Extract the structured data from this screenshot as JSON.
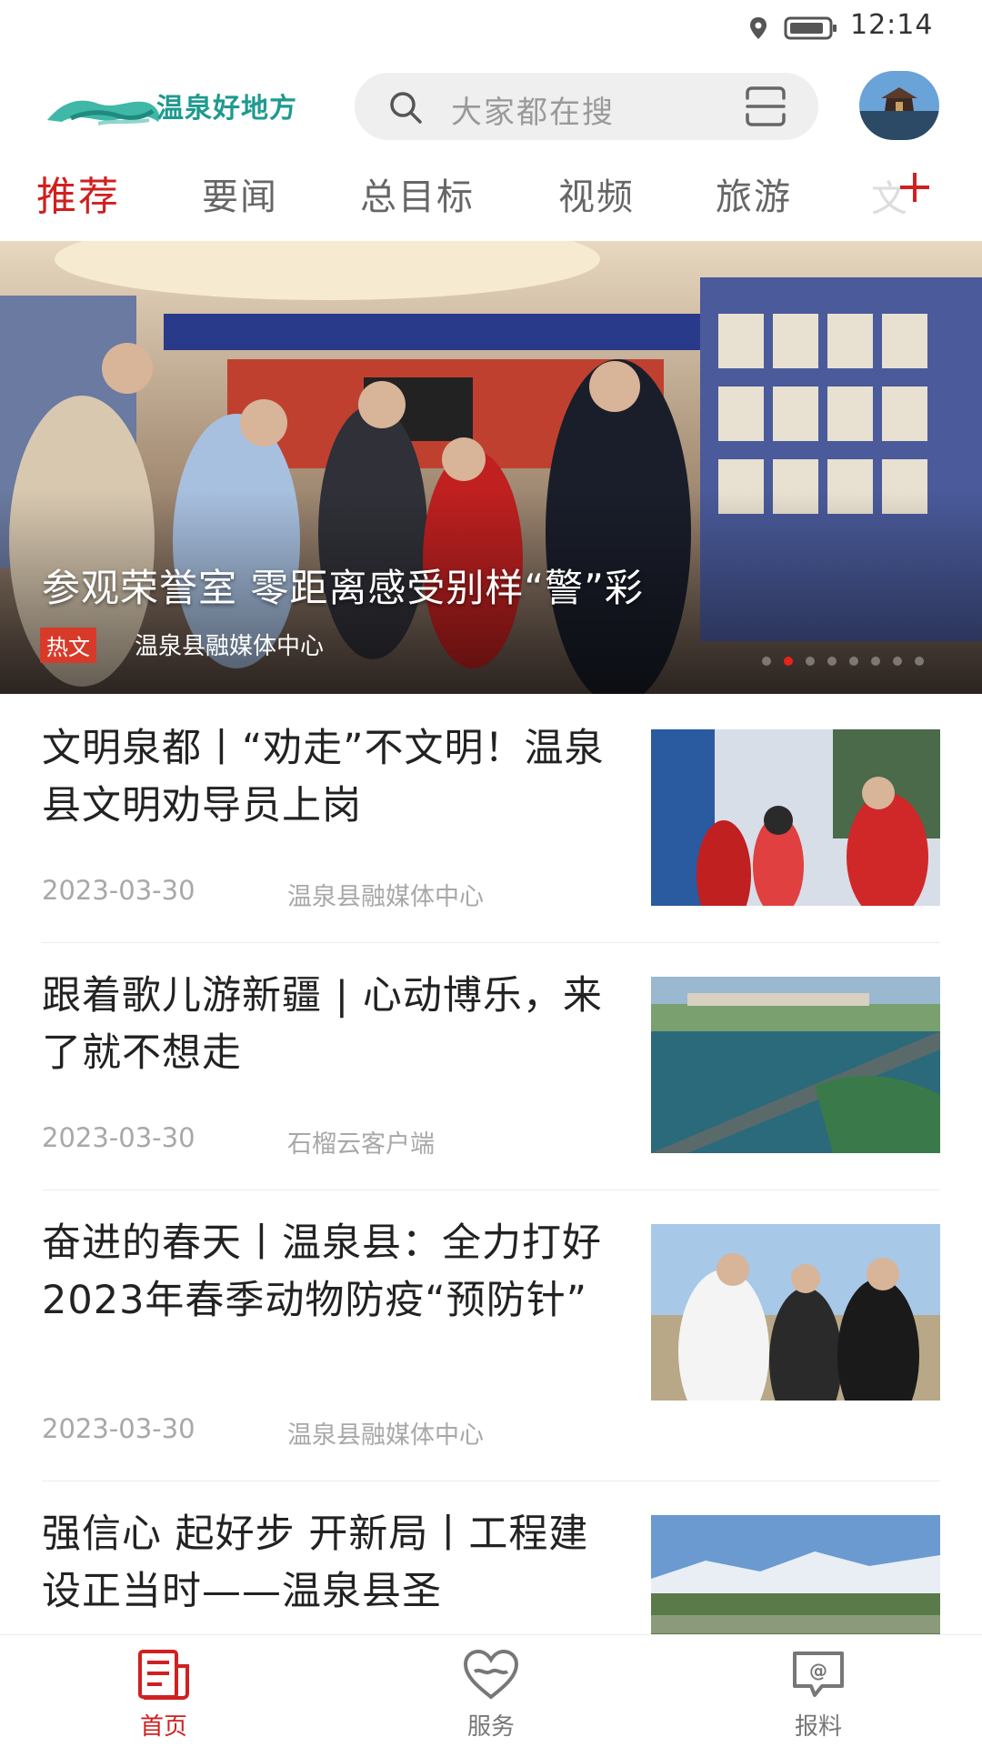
{
  "status_bar": {
    "time": "12:14",
    "icons": [
      "location-icon",
      "battery-icon"
    ]
  },
  "header": {
    "logo_text": "温泉好地方",
    "search_placeholder": "大家都在搜",
    "icons": [
      "search-icon",
      "scan-icon",
      "avatar"
    ]
  },
  "tabs": {
    "items": [
      "推荐",
      "要闻",
      "总目标",
      "视频",
      "旅游"
    ],
    "overflow": "文",
    "active": "推荐",
    "add_icon": "plus-icon",
    "active_color": "#d02020"
  },
  "hero": {
    "title": "参观荣誉室  零距离感受别样“警”彩",
    "tag": "热文",
    "source": "温泉县融媒体中心",
    "dot_count": 8,
    "active_dot": 1
  },
  "news": [
    {
      "title": "文明泉都丨“劝走”不文明！温泉县文明劝导员上岗",
      "date": "2023-03-30",
      "source": "温泉县融媒体中心"
    },
    {
      "title": "跟着歌儿游新疆 | 心动博乐，来了就不想走",
      "date": "2023-03-30",
      "source": "石榴云客户端"
    },
    {
      "title": "奋进的春天丨温泉县：全力打好2023年春季动物防疫“预防针”",
      "date": "2023-03-30",
      "source": "温泉县融媒体中心"
    },
    {
      "title": "强信心 起好步 开新局丨工程建设正当时——温泉县圣",
      "date": "",
      "source": ""
    }
  ],
  "bottom_nav": {
    "items": [
      {
        "label": "首页",
        "icon": "news-icon",
        "active": true
      },
      {
        "label": "服务",
        "icon": "heart-icon",
        "active": false
      },
      {
        "label": "报料",
        "icon": "message-icon",
        "active": false
      }
    ]
  },
  "colors": {
    "accent": "#d02020",
    "logo": "#1f9a8e",
    "meta": "#a8a8a8"
  }
}
